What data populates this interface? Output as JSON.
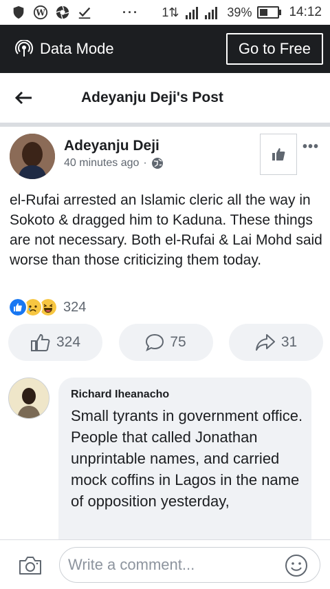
{
  "status_bar": {
    "dots": "···",
    "network": "1⇅",
    "battery_text": "39%",
    "battery_level": 0.39,
    "time": "14:12"
  },
  "data_bar": {
    "label": "Data Mode",
    "button": "Go to Free"
  },
  "header": {
    "title": "Adeyanju Deji's Post"
  },
  "post": {
    "author": "Adeyanju Deji",
    "time": "40 minutes ago",
    "separator": "·",
    "text": "el-Rufai arrested an Islamic cleric all the way in Sokoto & dragged him to Kaduna. These things are not necessary. Both el-Rufai & Lai Mohd said worse than those criticizing them today.",
    "reaction_count": "324",
    "actions": {
      "likes": "324",
      "comments": "75",
      "shares": "31"
    }
  },
  "comment": {
    "author": "Richard Iheanacho",
    "text": "Small tyrants in government office.\nPeople that called Jonathan unprintable names, and carried mock coffins in Lagos in the name of opposition yesterday,"
  },
  "composer": {
    "placeholder": "Write a comment..."
  },
  "icons": [
    "shield-icon",
    "wordpress-icon",
    "aperture-icon",
    "download-check-icon",
    "signal-icon",
    "battery-icon",
    "data-mode-icon",
    "back-arrow-icon",
    "globe-icon",
    "like-icon",
    "comment-icon",
    "share-icon",
    "camera-icon",
    "smiley-icon"
  ],
  "colors": {
    "data_bar_bg": "#1c1e21",
    "like_blue": "#1877f2",
    "muted_text": "#606770",
    "pill_bg": "#f0f2f5"
  }
}
